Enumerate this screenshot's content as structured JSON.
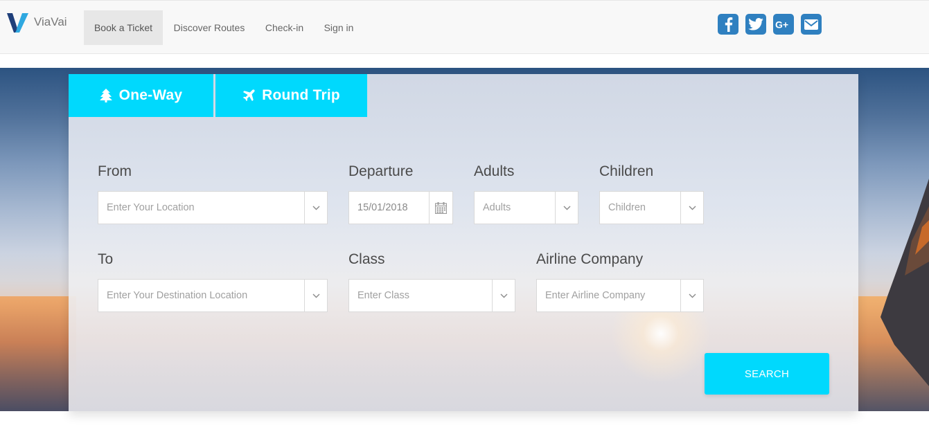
{
  "brand": {
    "name": "ViaVai"
  },
  "nav": {
    "items": [
      {
        "label": "Book a Ticket",
        "active": true
      },
      {
        "label": "Discover Routes"
      },
      {
        "label": "Check-in"
      },
      {
        "label": "Sign in"
      }
    ]
  },
  "social": [
    {
      "icon": "facebook-icon"
    },
    {
      "icon": "twitter-icon"
    },
    {
      "icon": "google-plus-icon"
    },
    {
      "icon": "envelope-icon"
    }
  ],
  "tabs": [
    {
      "label": "One-Way",
      "icon": "tree-icon"
    },
    {
      "label": "Round Trip",
      "icon": "plane-icon"
    }
  ],
  "form": {
    "from": {
      "label": "From",
      "placeholder": "Enter Your Location"
    },
    "departure": {
      "label": "Departure",
      "value": "15/01/2018"
    },
    "adults": {
      "label": "Adults",
      "placeholder": "Adults"
    },
    "children": {
      "label": "Children",
      "placeholder": "Children"
    },
    "to": {
      "label": "To",
      "placeholder": "Enter Your Destination Location"
    },
    "class": {
      "label": "Class",
      "placeholder": "Enter Class"
    },
    "airline": {
      "label": "Airline Company",
      "placeholder": "Enter Airline Company"
    },
    "search_label": "SEARCH"
  },
  "colors": {
    "accent": "#00d9fd",
    "social": "#2f80c0",
    "brand_dark": "#1f3f7a",
    "brand_light": "#2fa8e0"
  }
}
